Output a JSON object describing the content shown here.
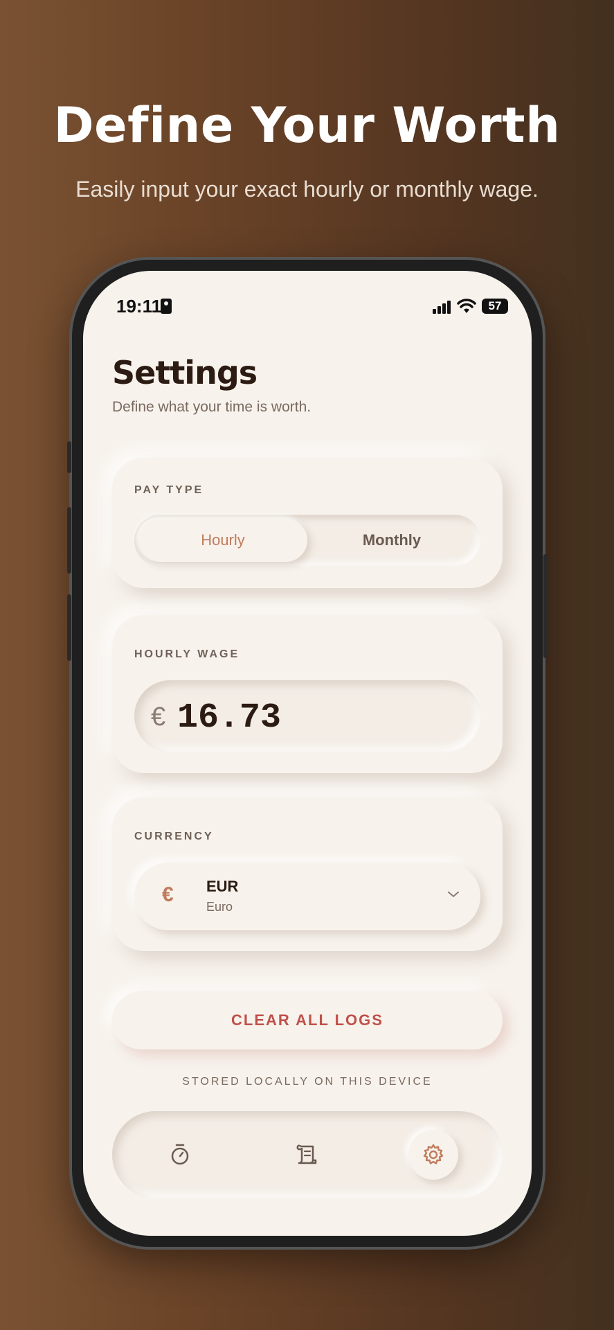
{
  "promo": {
    "headline": "Define Your Worth",
    "subheadline": "Easily input your exact hourly or monthly wage."
  },
  "status_bar": {
    "time": "19:11",
    "battery": "57"
  },
  "settings": {
    "title": "Settings",
    "subtitle": "Define what your time is worth."
  },
  "pay_type": {
    "label": "PAY TYPE",
    "options": [
      "Hourly",
      "Monthly"
    ],
    "selected": "Hourly"
  },
  "wage": {
    "label": "HOURLY WAGE",
    "currency_symbol": "€",
    "value": "16.73"
  },
  "currency": {
    "label": "CURRENCY",
    "symbol": "€",
    "code": "EUR",
    "name": "Euro"
  },
  "actions": {
    "clear_label": "CLEAR ALL LOGS",
    "storage_note": "STORED LOCALLY ON THIS DEVICE"
  },
  "tabbar": {
    "tabs": [
      "timer-icon",
      "log-scroll-icon",
      "settings-gear-icon"
    ],
    "active": "settings-gear-icon"
  },
  "colors": {
    "accent": "#c07b5c",
    "danger": "#c0504a",
    "surface": "#f7f2ec",
    "text": "#2b1b12"
  }
}
